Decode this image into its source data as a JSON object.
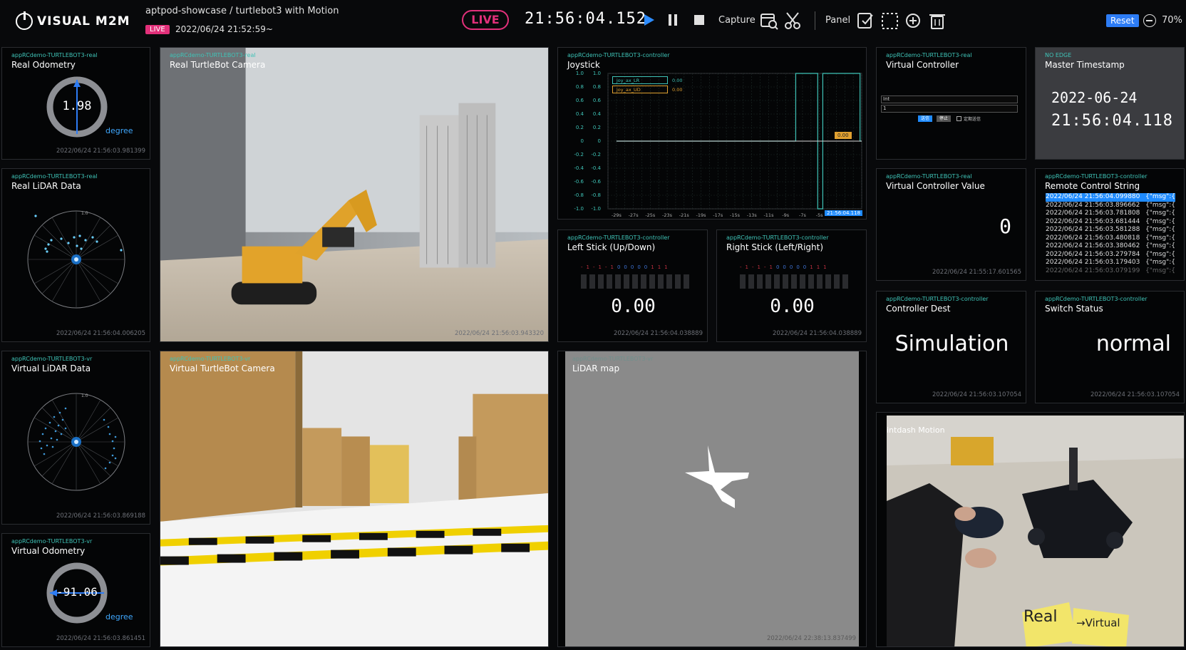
{
  "header": {
    "logo_text": "VISUAL M2M",
    "project_title": "aptpod-showcase / turtlebot3 with Motion",
    "live_badge": "LIVE",
    "start_time": "2022/06/24 21:52:59~",
    "live_indicator": "LIVE",
    "clock": "21:56:04.152",
    "capture_label": "Capture",
    "panel_label": "Panel",
    "reset_label": "Reset",
    "zoom": "70%"
  },
  "panels": {
    "real_odometry": {
      "tag": "appRCdemo-TURTLEBOT3-real",
      "title": "Real Odometry",
      "value": "1.98",
      "unit": "degree",
      "timestamp": "2022/06/24 21:56:03.981399",
      "heading_fraction": 0.0
    },
    "real_lidar": {
      "tag": "appRCdemo-TURTLEBOT3-real",
      "title": "Real LiDAR Data",
      "timestamp": "2022/06/24 21:56:04.006205",
      "ring_label": "1.0"
    },
    "virtual_lidar": {
      "tag": "appRCdemo-TURTLEBOT3-vr",
      "title": "Virtual LiDAR Data",
      "timestamp": "2022/06/24 21:56:03.869188",
      "ring_label": "1.0"
    },
    "virtual_odometry": {
      "tag": "appRCdemo-TURTLEBOT3-vr",
      "title": "Virtual Odometry",
      "value": "-91.06",
      "unit": "degree",
      "timestamp": "2022/06/24 21:56:03.861451"
    },
    "real_camera": {
      "tag": "appRCdemo-TURTLEBOT3-real",
      "title": "Real TurtleBot Camera",
      "timestamp": "2022/06/24 21:56:03.943320"
    },
    "virtual_camera": {
      "tag": "appRCdemo-TURTLEBOT3-vr",
      "title": "Virtual TurtleBot Camera"
    },
    "joystick": {
      "tag": "appRCdemo-TURTLEBOT3-controller",
      "title": "Joystick",
      "legend": [
        {
          "name": "joy_ax_LR",
          "value": "0.00",
          "color": "#3fc3b7"
        },
        {
          "name": "joy_ax_UD",
          "value": "0.00",
          "color": "#e0a030"
        }
      ],
      "marker_value": "0.00",
      "time_marker": "21:56:04.118"
    },
    "left_stick": {
      "tag": "appRCdemo-TURTLEBOT3-controller",
      "title": "Left Stick (Up/Down)",
      "value": "0.00",
      "timestamp": "2022/06/24 21:56:04.038889"
    },
    "right_stick": {
      "tag": "appRCdemo-TURTLEBOT3-controller",
      "title": "Right Stick (Left/Right)",
      "value": "0.00",
      "timestamp": "2022/06/24 21:56:04.038889"
    },
    "lidar_map": {
      "tag": "appRCdemo-TURTLEBOT3-vr",
      "title": "LiDAR map",
      "timestamp": "2022/06/24 22:38:13.837499"
    },
    "virtual_controller": {
      "tag": "appRCdemo-TURTLEBOT3-real",
      "title": "Virtual Controller",
      "select_value": "Int",
      "input_value": "1",
      "btn_send": "送信",
      "btn_stop": "停止",
      "checkbox_label": "定期送信"
    },
    "master_timestamp": {
      "tag": "NO EDGE",
      "title": "Master Timestamp",
      "date": "2022-06-24",
      "time": "21:56:04.118"
    },
    "vc_value": {
      "tag": "appRCdemo-TURTLEBOT3-real",
      "title": "Virtual Controller Value",
      "value": "0",
      "timestamp": "2022/06/24 21:55:17.601565"
    },
    "remote_control": {
      "tag": "appRCdemo-TURTLEBOT3-controller",
      "title": "Remote Control String",
      "rows": [
        {
          "time": "2022/06/24 21:56:04.099880",
          "msg": "{\"msg\":{"
        },
        {
          "time": "2022/06/24 21:56:03.896662",
          "msg": "{\"msg\":{"
        },
        {
          "time": "2022/06/24 21:56:03.781808",
          "msg": "{\"msg\":{"
        },
        {
          "time": "2022/06/24 21:56:03.681444",
          "msg": "{\"msg\":{"
        },
        {
          "time": "2022/06/24 21:56:03.581288",
          "msg": "{\"msg\":{"
        },
        {
          "time": "2022/06/24 21:56:03.480818",
          "msg": "{\"msg\":{"
        },
        {
          "time": "2022/06/24 21:56:03.380462",
          "msg": "{\"msg\":{"
        },
        {
          "time": "2022/06/24 21:56:03.279784",
          "msg": "{\"msg\":{"
        },
        {
          "time": "2022/06/24 21:56:03.179403",
          "msg": "{\"msg\":{"
        },
        {
          "time": "2022/06/24 21:56:03.079199",
          "msg": "{\"msg\":{"
        }
      ]
    },
    "controller_dest": {
      "tag": "appRCdemo-TURTLEBOT3-controller",
      "title": "Controller Dest",
      "value": "Simulation",
      "timestamp": "2022/06/24 21:56:03.107054"
    },
    "switch_status": {
      "tag": "appRCdemo-TURTLEBOT3-controller",
      "title": "Switch Status",
      "value": "normal",
      "timestamp": "2022/06/24 21:56:03.107054"
    },
    "motion": {
      "title": "intdash Motion",
      "note_real": "Real",
      "note_virtual": "→Virtual"
    }
  },
  "chart_data": {
    "type": "line",
    "series": [
      {
        "name": "joy_ax_LR",
        "x": [
          -29,
          -7.8,
          -7.8,
          -5.2,
          -5.2,
          -4.6,
          -4.6,
          -0.2,
          -0.2,
          0
        ],
        "values": [
          0,
          0,
          1,
          1,
          -1,
          -1,
          1,
          1,
          0,
          0
        ]
      },
      {
        "name": "joy_ax_UD",
        "x": [
          -29,
          0
        ],
        "values": [
          0,
          0
        ]
      }
    ],
    "xlabel": "",
    "ylabel": "",
    "x_ticks": [
      "-29s",
      "-27s",
      "-25s",
      "-23s",
      "-21s",
      "-19s",
      "-17s",
      "-15s",
      "-13s",
      "-11s",
      "-9s",
      "-7s",
      "-5s"
    ],
    "y_ticks": [
      "1.0",
      "0.8",
      "0.6",
      "0.4",
      "0.2",
      "0",
      "-0.2",
      "-0.4",
      "-0.6",
      "-0.8",
      "-1.0"
    ],
    "xlim": [
      -30,
      0
    ],
    "ylim": [
      -1,
      1
    ],
    "grid": true
  }
}
